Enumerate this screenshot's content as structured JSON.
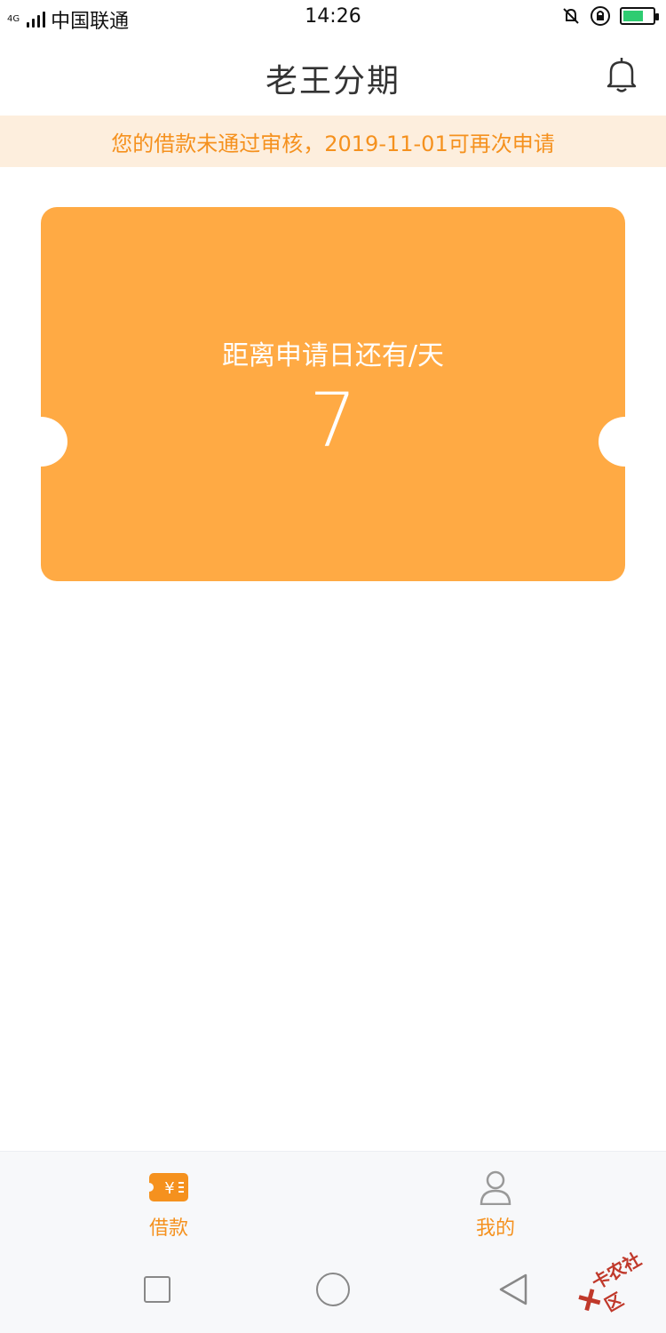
{
  "status_bar": {
    "network": "4G",
    "carrier": "中国联通",
    "time": "14:26"
  },
  "header": {
    "title": "老王分期",
    "bell_icon": "bell-icon"
  },
  "notice": {
    "text": "您的借款未通过审核，2019-11-01可再次申请"
  },
  "card": {
    "label": "距离申请日还有/天",
    "value": "7",
    "color": "#ffaa44"
  },
  "tabs": [
    {
      "label": "借款",
      "icon": "loan-icon",
      "active": true
    },
    {
      "label": "我的",
      "icon": "user-icon",
      "active": false
    }
  ],
  "watermark": {
    "text": "卡农社区"
  },
  "colors": {
    "accent": "#f5911e",
    "notice_bg": "#fdeedd",
    "card_bg": "#ffaa44"
  }
}
